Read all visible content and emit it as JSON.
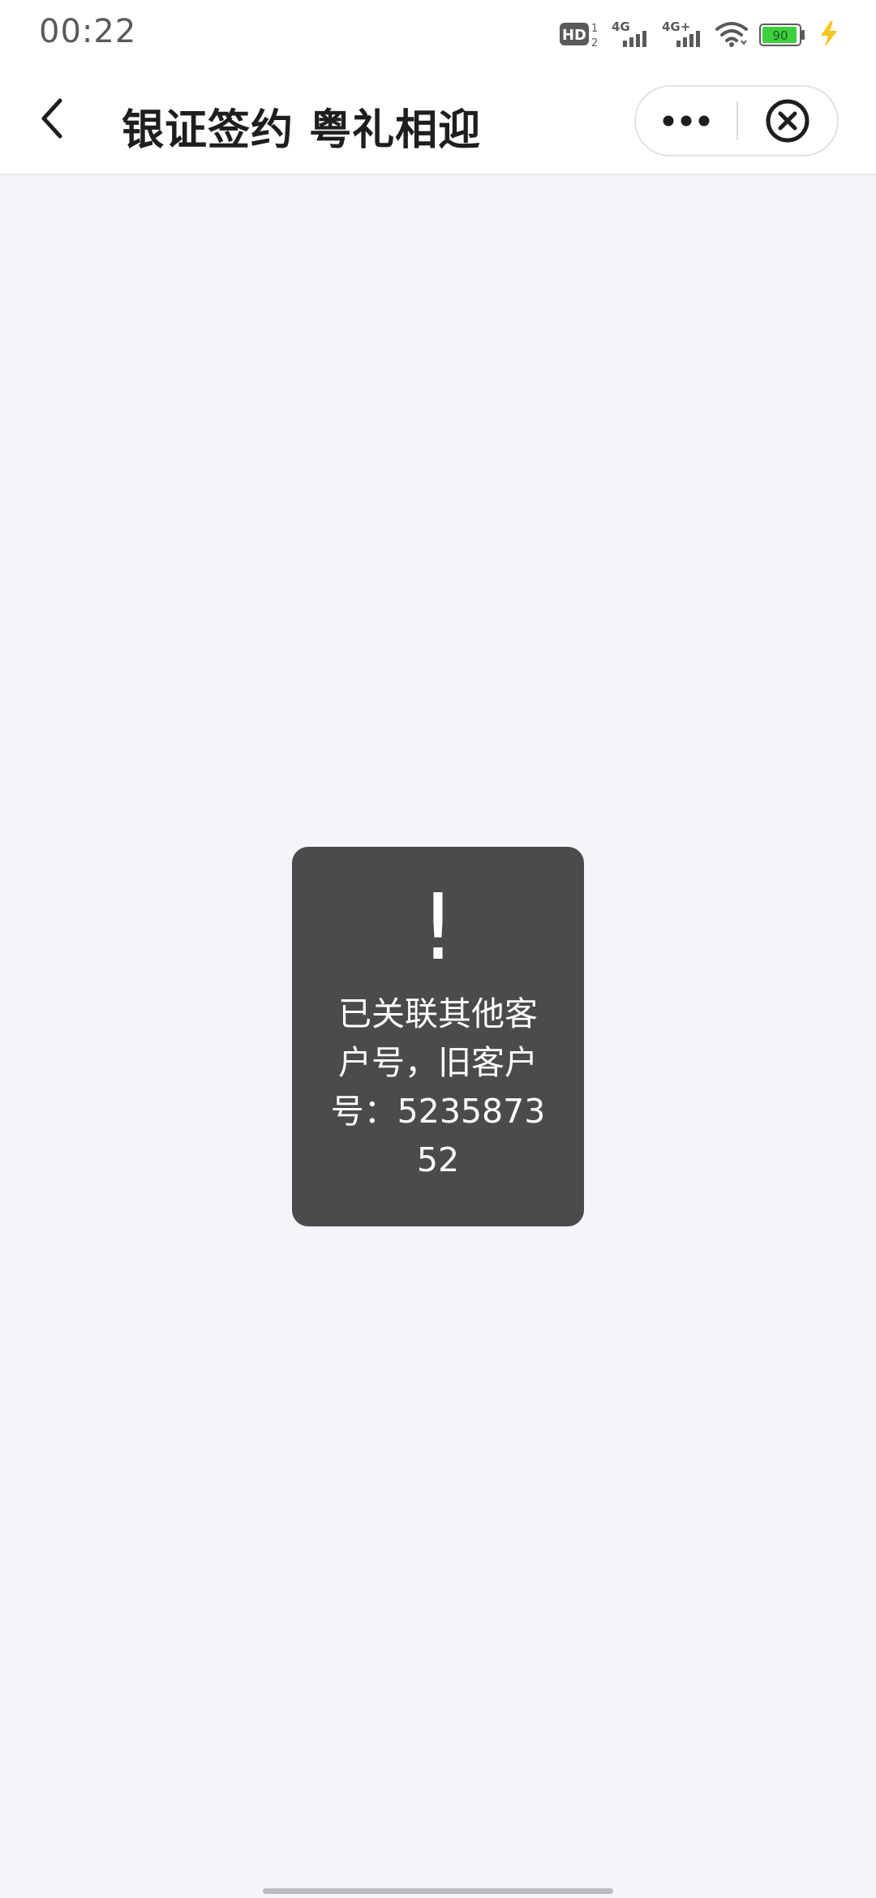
{
  "status_bar": {
    "time": "00:22",
    "hd_label": "HD",
    "sim1_label": "4G",
    "sim2_label": "4G+",
    "battery_level": "90",
    "battery_color": "#3ecf3e",
    "charging_color": "#f5c518"
  },
  "nav": {
    "title": "银证签约 粤礼相迎",
    "back_icon": "chevron-left-icon",
    "more_icon": "more-dots-icon",
    "close_icon": "close-circle-icon"
  },
  "toast": {
    "icon": "!",
    "message": "已关联其他客户号，旧客户号：523587352",
    "background": "#4a4b4d"
  },
  "colors": {
    "page_background": "#f4f5f9",
    "nav_background": "#ffffff"
  }
}
